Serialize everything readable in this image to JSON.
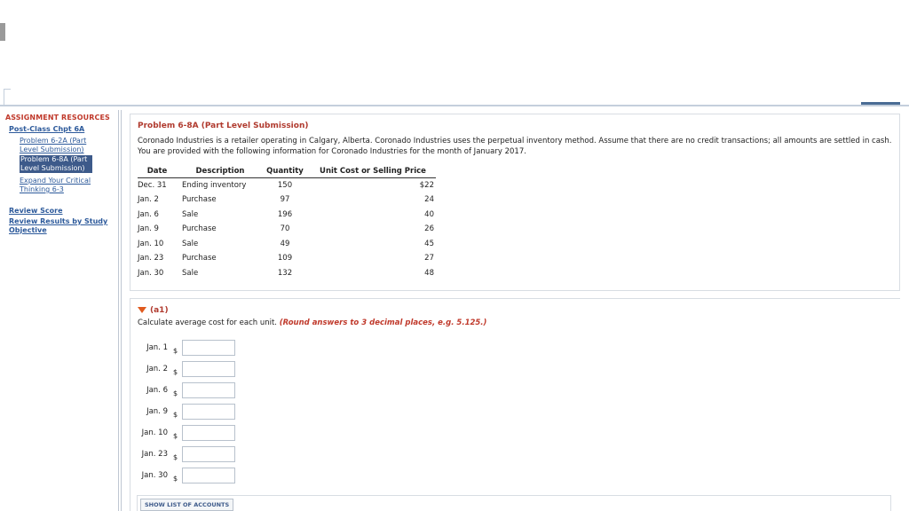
{
  "sidebar": {
    "heading": "ASSIGNMENT RESOURCES",
    "section_link": "Post-Class Chpt 6A",
    "items": [
      {
        "line1": "Problem 6-2A (Part",
        "line2": "Level Submission)"
      },
      {
        "line1": "Problem 6-8A (Part",
        "line2": "Level Submission)"
      },
      {
        "line1": "Expand Your Critical",
        "line2": "Thinking 6-3"
      }
    ],
    "review_score": "Review Score",
    "review_results_line1": "Review Results by Study",
    "review_results_line2": "Objective"
  },
  "problem": {
    "title": "Problem 6-8A (Part Level Submission)",
    "description": "Coronado Industries is a retailer operating in Calgary, Alberta. Coronado Industries uses the perpetual inventory method. Assume that there are no credit transactions; all amounts are settled in cash. You are provided with the following information for Coronado Industries for the month of January 2017.",
    "table": {
      "headers": [
        "Date",
        "Description",
        "Quantity",
        "Unit Cost or Selling Price"
      ],
      "rows": [
        [
          "Dec. 31",
          "Ending inventory",
          "150",
          "$22"
        ],
        [
          "Jan. 2",
          "Purchase",
          "97",
          "24"
        ],
        [
          "Jan. 6",
          "Sale",
          "196",
          "40"
        ],
        [
          "Jan. 9",
          "Purchase",
          "70",
          "26"
        ],
        [
          "Jan. 10",
          "Sale",
          "49",
          "45"
        ],
        [
          "Jan. 23",
          "Purchase",
          "109",
          "27"
        ],
        [
          "Jan. 30",
          "Sale",
          "132",
          "48"
        ]
      ]
    }
  },
  "question": {
    "label": "(a1)",
    "text": "Calculate average cost for each unit.",
    "hint": "(Round answers to 3 decimal places, e.g. 5.125.)",
    "currency": "$",
    "answers": [
      {
        "date": "Jan. 1",
        "value": ""
      },
      {
        "date": "Jan. 2",
        "value": ""
      },
      {
        "date": "Jan. 6",
        "value": ""
      },
      {
        "date": "Jan. 9",
        "value": ""
      },
      {
        "date": "Jan. 10",
        "value": ""
      },
      {
        "date": "Jan. 23",
        "value": ""
      },
      {
        "date": "Jan. 30",
        "value": ""
      }
    ]
  },
  "show_list_button": "SHOW LIST OF ACCOUNTS",
  "colors": {
    "accent_red": "#b03a2e",
    "link_blue": "#2d5a9b",
    "selected_bg": "#3d5a8a",
    "arrow_orange": "#e05a1e"
  }
}
